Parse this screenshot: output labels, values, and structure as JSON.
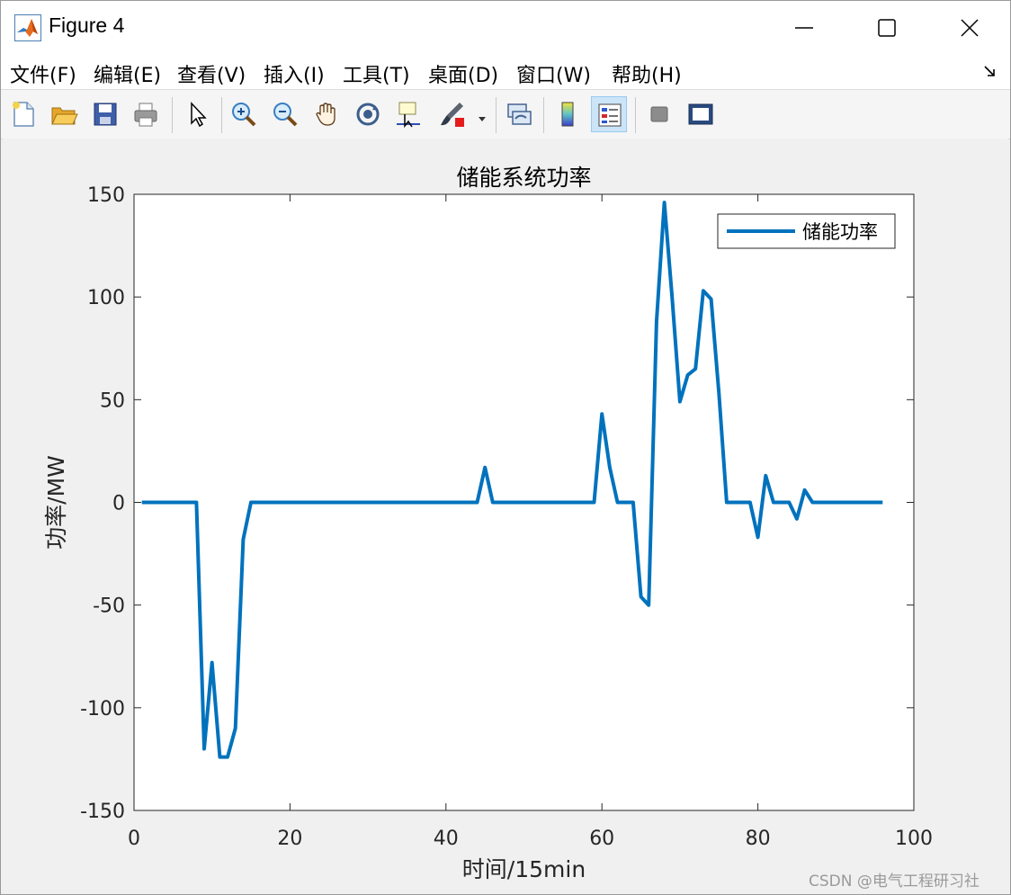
{
  "window": {
    "title": "Figure 4",
    "icon": "matlab-icon",
    "controls": [
      "minimize-icon",
      "maximize-icon",
      "close-icon"
    ]
  },
  "menu": {
    "items": [
      "文件(F)",
      "编辑(E)",
      "查看(V)",
      "插入(I)",
      "工具(T)",
      "桌面(D)",
      "窗口(W)",
      "帮助(H)"
    ]
  },
  "toolbar": {
    "buttons": [
      "new-figure-icon",
      "open-file-icon",
      "save-icon",
      "print-icon",
      "edit-plot-arrow-icon",
      "zoom-in-icon",
      "zoom-out-icon",
      "pan-hand-icon",
      "rotate-3d-icon",
      "data-cursor-icon",
      "brush-icon",
      "link-plot-icon",
      "insert-colorbar-icon",
      "insert-legend-icon",
      "hide-plot-tools-icon",
      "show-plot-tools-icon"
    ],
    "active": "insert-legend-icon"
  },
  "chart_data": {
    "type": "line",
    "title": "储能系统功率",
    "xlabel": "时间/15min",
    "ylabel": "功率/MW",
    "xlim": [
      0,
      100
    ],
    "ylim": [
      -150,
      150
    ],
    "xticks": [
      "0",
      "20",
      "40",
      "60",
      "80",
      "100"
    ],
    "yticks": [
      "150",
      "100",
      "50",
      "0",
      "-50",
      "-100",
      "-150"
    ],
    "grid": false,
    "legend_position": "top-right",
    "series": [
      {
        "name": "储能功率",
        "color": "#0072BD",
        "x": [
          1,
          2,
          3,
          4,
          5,
          6,
          7,
          8,
          9,
          10,
          11,
          12,
          13,
          14,
          15,
          16,
          17,
          18,
          19,
          20,
          21,
          22,
          23,
          24,
          25,
          26,
          27,
          28,
          29,
          30,
          31,
          32,
          33,
          34,
          35,
          36,
          37,
          38,
          39,
          40,
          41,
          42,
          43,
          44,
          45,
          46,
          47,
          48,
          49,
          50,
          51,
          52,
          53,
          54,
          55,
          56,
          57,
          58,
          59,
          60,
          61,
          62,
          63,
          64,
          65,
          66,
          67,
          68,
          69,
          70,
          71,
          72,
          73,
          74,
          75,
          76,
          77,
          78,
          79,
          80,
          81,
          82,
          83,
          84,
          85,
          86,
          87,
          88,
          89,
          90,
          91,
          92,
          93,
          94,
          95,
          96
        ],
        "y": [
          0,
          0,
          0,
          0,
          0,
          0,
          0,
          0,
          -120,
          -78,
          -124,
          -124,
          -110,
          -18,
          0,
          0,
          0,
          0,
          0,
          0,
          0,
          0,
          0,
          0,
          0,
          0,
          0,
          0,
          0,
          0,
          0,
          0,
          0,
          0,
          0,
          0,
          0,
          0,
          0,
          0,
          0,
          0,
          0,
          0,
          17,
          0,
          0,
          0,
          0,
          0,
          0,
          0,
          0,
          0,
          0,
          0,
          0,
          0,
          0,
          43,
          17,
          0,
          0,
          0,
          -46,
          -50,
          88,
          146,
          100,
          49,
          62,
          65,
          103,
          99,
          53,
          0,
          0,
          0,
          0,
          -17,
          13,
          0,
          0,
          0,
          -8,
          6,
          0,
          0,
          0,
          0,
          0,
          0,
          0,
          0,
          0,
          0
        ]
      }
    ]
  },
  "watermark": "CSDN @电气工程研习社"
}
